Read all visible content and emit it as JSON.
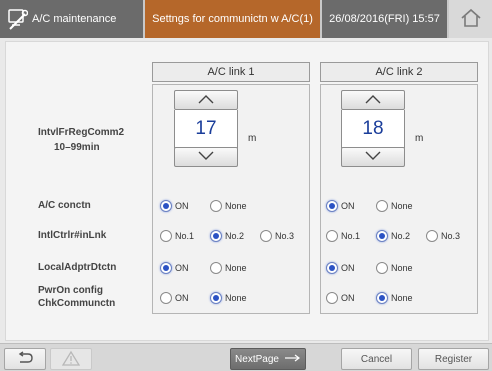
{
  "header": {
    "title": "A/C maintenance",
    "subtitle": "Settngs for communictn w A/C(1)",
    "datetime": "26/08/2016(FRI) 15:57"
  },
  "columns": [
    {
      "title": "A/C link 1"
    },
    {
      "title": "A/C link 2"
    }
  ],
  "interval": {
    "label": "IntvlFrRegComm2",
    "range": "10–99min",
    "unit": "m",
    "values": [
      "17",
      "18"
    ]
  },
  "rows": [
    {
      "label": "A/C conctn",
      "options": [
        "ON",
        "None"
      ],
      "selected": [
        "ON",
        "ON"
      ]
    },
    {
      "label": "IntlCtrlr#inLnk",
      "options": [
        "No.1",
        "No.2",
        "No.3"
      ],
      "selected": [
        "No.2",
        "No.2"
      ]
    },
    {
      "label": "LocalAdptrDtctn",
      "options": [
        "ON",
        "None"
      ],
      "selected": [
        "ON",
        "ON"
      ]
    },
    {
      "label_line1": "PwrOn config",
      "label_line2": "ChkCommunctn",
      "options": [
        "ON",
        "None"
      ],
      "selected": [
        "None",
        "None"
      ]
    }
  ],
  "footer": {
    "next_page": "NextPage",
    "cancel": "Cancel",
    "register": "Register"
  }
}
